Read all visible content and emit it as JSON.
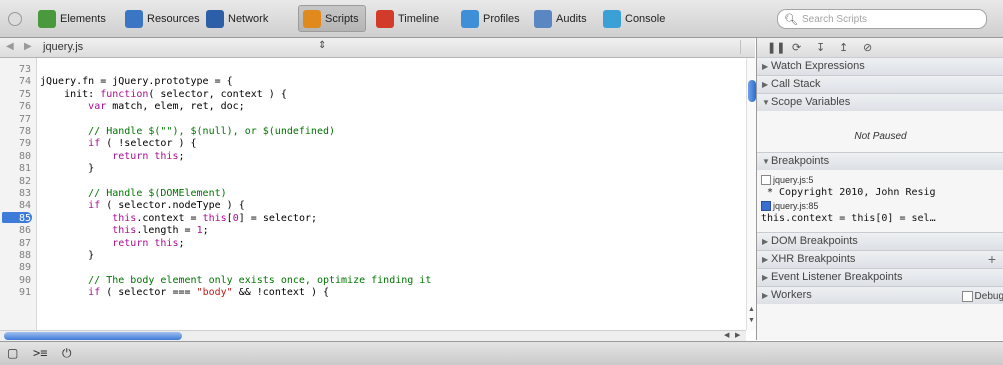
{
  "toolbar": {
    "tabs": [
      {
        "label": "Elements",
        "icon": "elements-icon",
        "color": "#4a9a3d"
      },
      {
        "label": "Resources",
        "icon": "resources-icon",
        "color": "#3b76c4"
      },
      {
        "label": "Network",
        "icon": "network-icon",
        "color": "#2c5fa8"
      },
      {
        "label": "Scripts",
        "icon": "scripts-icon",
        "color": "#e08a1e",
        "active": true
      },
      {
        "label": "Timeline",
        "icon": "timeline-icon",
        "color": "#d23a2a"
      },
      {
        "label": "Profiles",
        "icon": "profiles-icon",
        "color": "#3f8fd8"
      },
      {
        "label": "Audits",
        "icon": "audits-icon",
        "color": "#5a86c2"
      },
      {
        "label": "Console",
        "icon": "console-icon",
        "color": "#3aa0d6"
      }
    ],
    "search_placeholder": "Search Scripts"
  },
  "editor": {
    "file_name": "jquery.js",
    "selector_glyph": "⇕",
    "back_glyph": "◀",
    "forward_glyph": "▶",
    "breakpoint_line": "85",
    "lines": [
      {
        "n": "73",
        "parts": []
      },
      {
        "n": "74",
        "parts": [
          [
            "",
            "jQuery.fn = jQuery.prototype = {"
          ]
        ]
      },
      {
        "n": "75",
        "parts": [
          [
            "",
            "    init: "
          ],
          [
            "kw",
            "function"
          ],
          [
            "",
            "( selector, context ) {"
          ]
        ]
      },
      {
        "n": "76",
        "parts": [
          [
            "",
            "        "
          ],
          [
            "kw",
            "var"
          ],
          [
            "",
            " match, elem, ret, doc;"
          ]
        ]
      },
      {
        "n": "77",
        "parts": []
      },
      {
        "n": "78",
        "parts": [
          [
            "cm",
            "        // Handle $(\"\"), $(null), or $(undefined)"
          ]
        ]
      },
      {
        "n": "79",
        "parts": [
          [
            "",
            "        "
          ],
          [
            "kw",
            "if"
          ],
          [
            "",
            " ( !selector ) {"
          ]
        ]
      },
      {
        "n": "80",
        "parts": [
          [
            "",
            "            "
          ],
          [
            "kw",
            "return this"
          ],
          [
            "",
            ";"
          ]
        ]
      },
      {
        "n": "81",
        "parts": [
          [
            "",
            "        }"
          ]
        ]
      },
      {
        "n": "82",
        "parts": []
      },
      {
        "n": "83",
        "parts": [
          [
            "cm",
            "        // Handle $(DOMElement)"
          ]
        ]
      },
      {
        "n": "84",
        "parts": [
          [
            "",
            "        "
          ],
          [
            "kw",
            "if"
          ],
          [
            "",
            " ( selector.nodeType ) {"
          ]
        ]
      },
      {
        "n": "85",
        "parts": [
          [
            "",
            "            "
          ],
          [
            "kw",
            "this"
          ],
          [
            "",
            ".context = "
          ],
          [
            "kw",
            "this"
          ],
          [
            "",
            "["
          ],
          [
            "kw",
            "0"
          ],
          [
            "",
            "] = selector;"
          ]
        ]
      },
      {
        "n": "86",
        "parts": [
          [
            "",
            "            "
          ],
          [
            "kw",
            "this"
          ],
          [
            "",
            ".length = "
          ],
          [
            "kw",
            "1"
          ],
          [
            "",
            ";"
          ]
        ]
      },
      {
        "n": "87",
        "parts": [
          [
            "",
            "            "
          ],
          [
            "kw",
            "return this"
          ],
          [
            "",
            ";"
          ]
        ]
      },
      {
        "n": "88",
        "parts": [
          [
            "",
            "        }"
          ]
        ]
      },
      {
        "n": "89",
        "parts": []
      },
      {
        "n": "90",
        "parts": [
          [
            "cm",
            "        // The body element only exists once, optimize finding it"
          ]
        ]
      },
      {
        "n": "91",
        "parts": [
          [
            "",
            "        "
          ],
          [
            "kw",
            "if"
          ],
          [
            "",
            " ( selector === "
          ],
          [
            "st",
            "\"body\""
          ],
          [
            "",
            " && !context ) {"
          ]
        ]
      }
    ]
  },
  "sidebar": {
    "debug_buttons": [
      "❚❚",
      "⟳",
      "↧",
      "↥",
      "⊘"
    ],
    "sections": {
      "watch": "Watch Expressions",
      "call_stack": "Call Stack",
      "scope": "Scope Variables",
      "breakpoints": "Breakpoints",
      "dom_breakpoints": "DOM Breakpoints",
      "xhr_breakpoints": "XHR Breakpoints",
      "event_breakpoints": "Event Listener Breakpoints",
      "workers": "Workers"
    },
    "not_paused": "Not Paused",
    "breakpoint_items": [
      {
        "location": "jquery.js:5",
        "source": "* Copyright 2010, John Resig",
        "checked": false
      },
      {
        "location": "jquery.js:85",
        "source": "this.context = this[0] = sel…",
        "checked": true
      }
    ],
    "xhr_add": "+",
    "workers_debug_label": "Debug"
  },
  "status_bar": {
    "buttons": [
      "dock-icon",
      "console-toggle-icon",
      "pause-on-exceptions-icon"
    ]
  }
}
